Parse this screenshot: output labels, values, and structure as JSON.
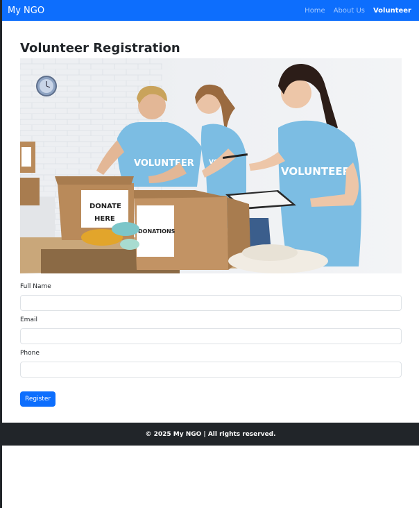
{
  "navbar": {
    "brand": "My NGO",
    "links": [
      {
        "label": "Home",
        "active": false
      },
      {
        "label": "About Us",
        "active": false
      },
      {
        "label": "Volunteer",
        "active": true
      }
    ]
  },
  "page": {
    "title": "Volunteer Registration"
  },
  "hero_image": {
    "shirt_text": "VOLUNTEER",
    "box_label_1": "DONATE HERE",
    "box_label_2": "DONATIONS"
  },
  "form": {
    "fields": [
      {
        "label": "Full Name",
        "value": "",
        "placeholder": ""
      },
      {
        "label": "Email",
        "value": "",
        "placeholder": ""
      },
      {
        "label": "Phone",
        "value": "",
        "placeholder": ""
      }
    ],
    "submit_label": "Register"
  },
  "footer": {
    "text": "© 2025 My NGO | All rights reserved."
  },
  "colors": {
    "primary": "#0d6efd",
    "dark": "#212529",
    "shirt": "#7cbde3",
    "cardboard": "#b98a5a"
  }
}
